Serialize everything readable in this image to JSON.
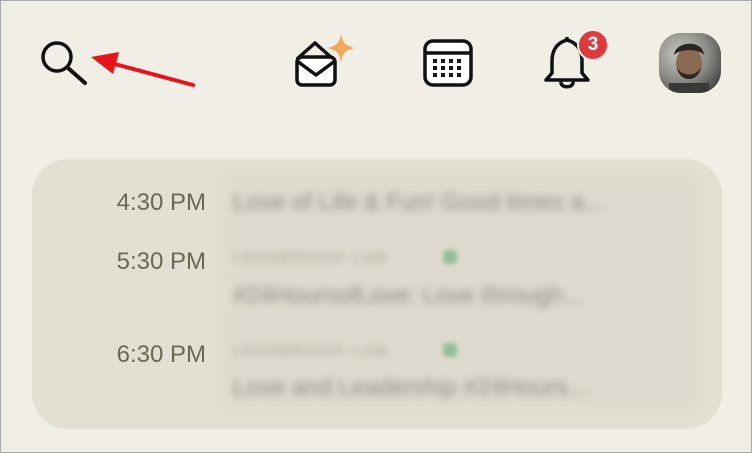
{
  "header": {
    "icons": {
      "search": "search-icon",
      "invites": "envelope-sparkle-icon",
      "calendar": "calendar-icon",
      "notifications": "bell-icon"
    },
    "notification_badge": "3",
    "avatar": "avatar"
  },
  "colors": {
    "background": "#f1eee5",
    "card": "#e3dfd3",
    "badge": "#df3a3e",
    "annotation_arrow": "#e8141c",
    "sparkle": "#f2a95a",
    "club_dot": "#5ab073",
    "time_text": "#6c6752"
  },
  "events": [
    {
      "time": "4:30 PM",
      "title": "Love of Life & Fun! Good times a..."
    },
    {
      "time": "5:30 PM",
      "club": "LEADERSHIP LAB",
      "title": "#24HoursofLove: Love through..."
    },
    {
      "time": "6:30 PM",
      "club": "LEADERSHIP LAB",
      "title": "Love and Leadership #24Hours..."
    }
  ]
}
